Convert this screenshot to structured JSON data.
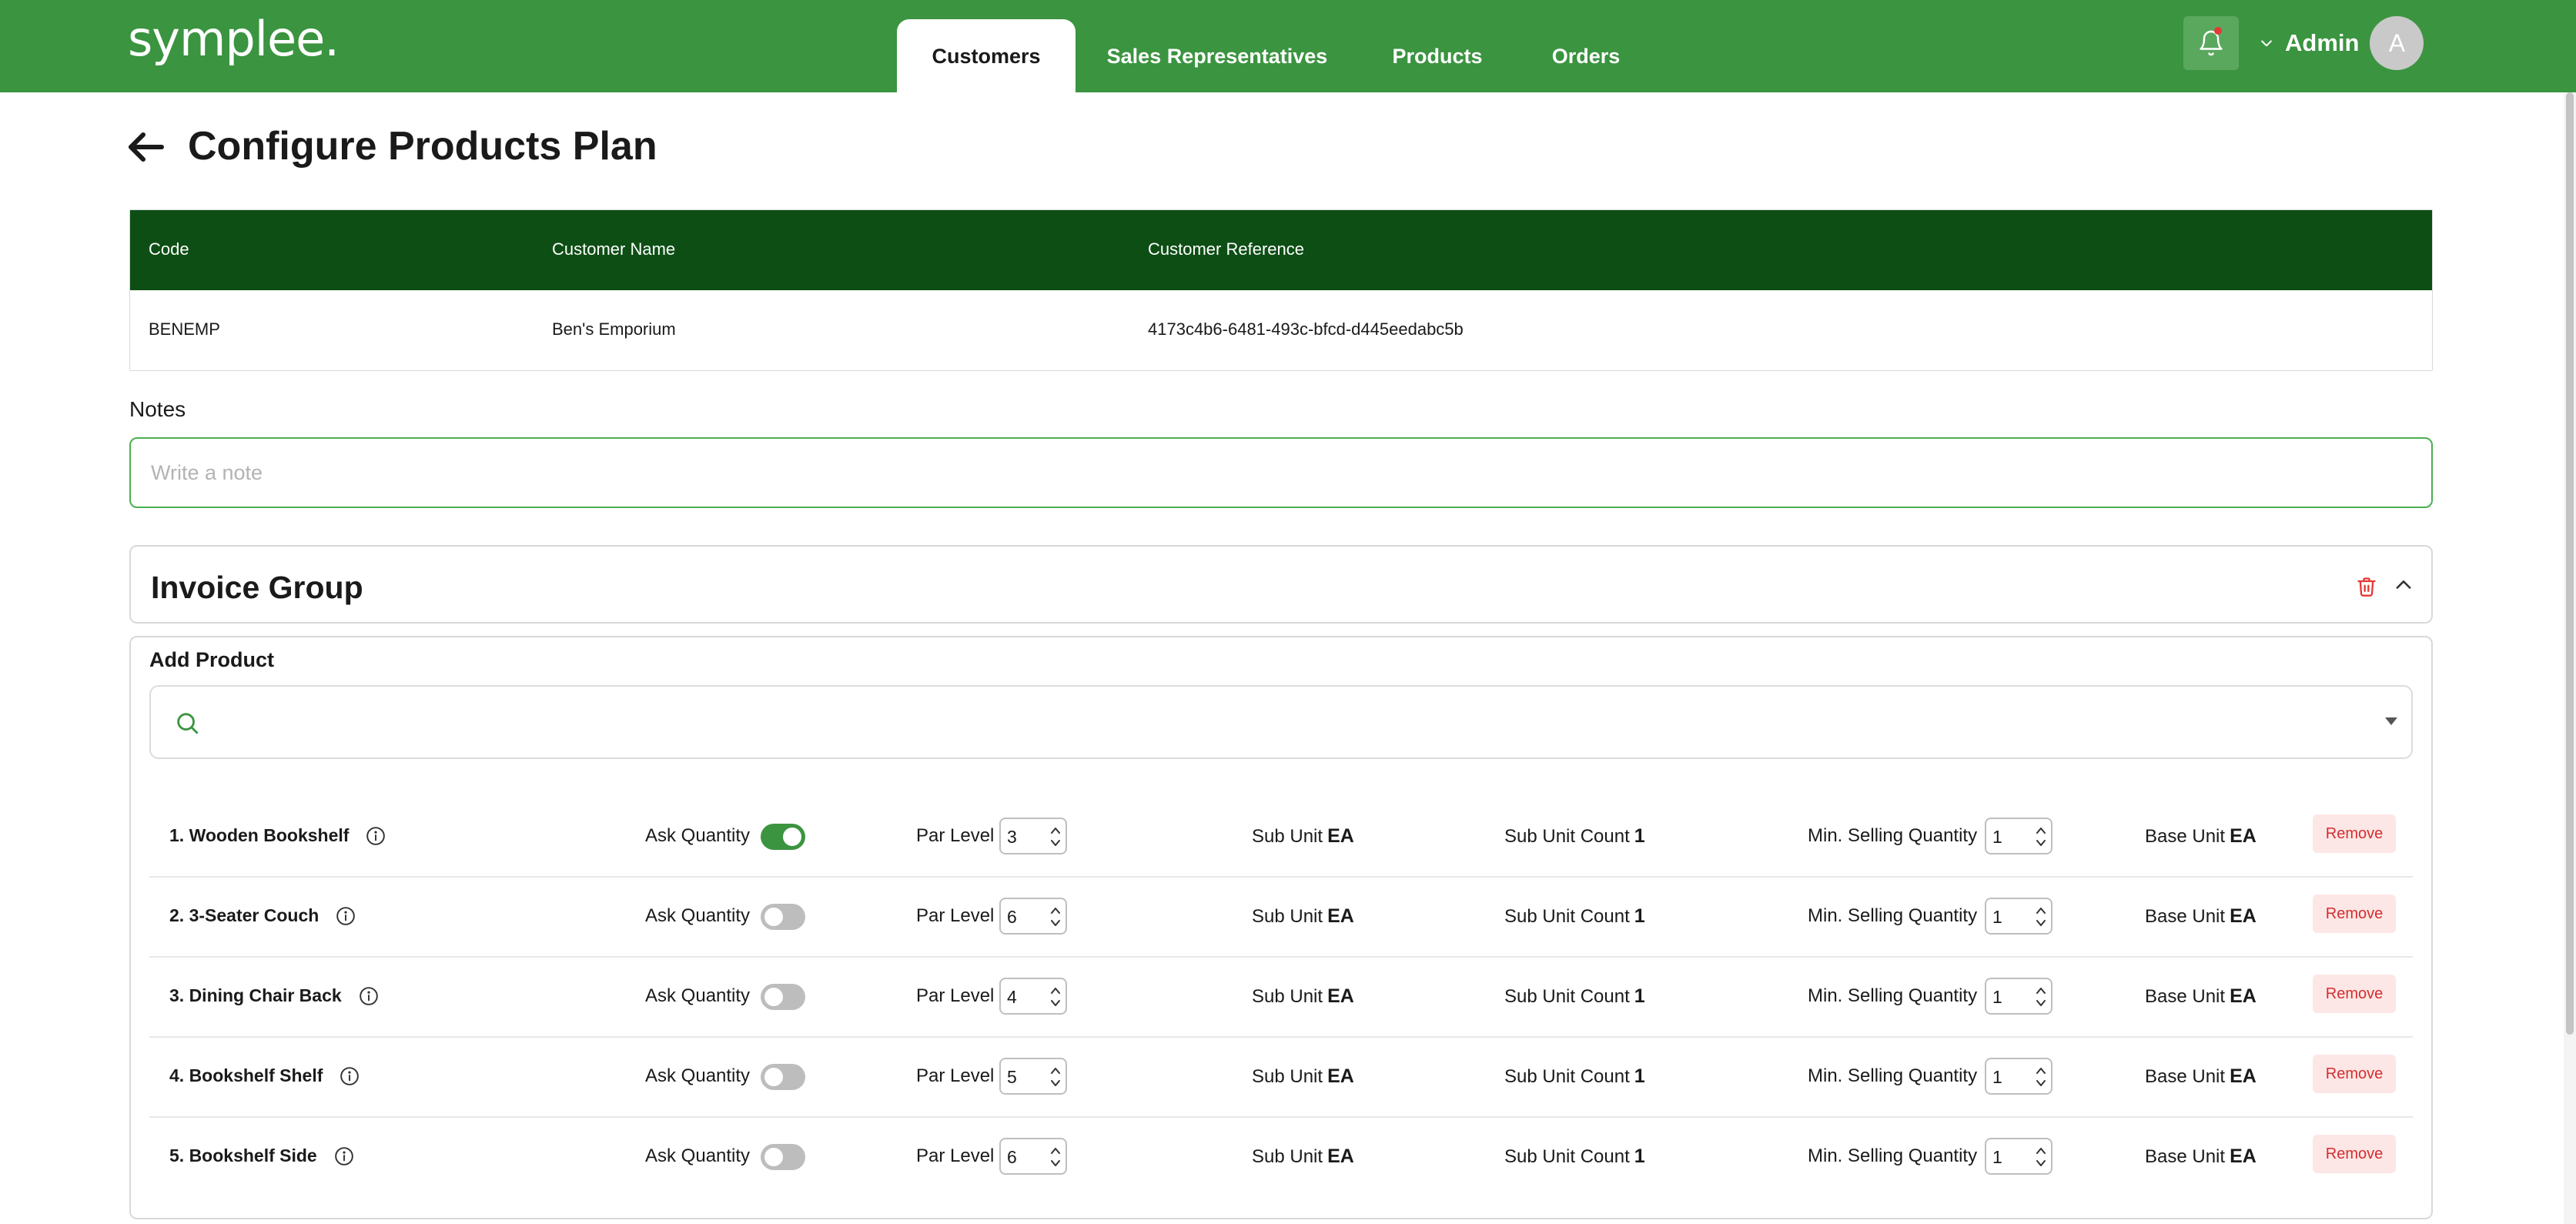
{
  "app": {
    "logo": "symplee."
  },
  "nav": {
    "tabs": [
      {
        "label": "Customers",
        "active": true
      },
      {
        "label": "Sales Representatives",
        "active": false
      },
      {
        "label": "Products",
        "active": false
      },
      {
        "label": "Orders",
        "active": false
      }
    ],
    "user": {
      "name": "Admin",
      "avatar_initial": "A"
    },
    "icons": {
      "notifications": "bell-icon",
      "user_menu": "chevron-down-icon"
    }
  },
  "page": {
    "title": "Configure Products Plan",
    "back_icon": "arrow-left-icon"
  },
  "customer_table": {
    "headers": [
      "Code",
      "Customer Name",
      "Customer Reference"
    ],
    "row": [
      "BENEMP",
      "Ben's Emporium",
      "4173c4b6-6481-493c-bfcd-d445eedabc5b"
    ]
  },
  "notes": {
    "label": "Notes",
    "placeholder": "Write a note",
    "value": ""
  },
  "invoice_group": {
    "title": "Invoice Group",
    "add_product_label": "Add Product",
    "search_value": "",
    "labels": {
      "ask_quantity": "Ask Quantity",
      "par_level": "Par Level",
      "sub_unit": "Sub Unit",
      "sub_unit_count": "Sub Unit Count",
      "min_selling_quantity": "Min. Selling Quantity",
      "base_unit": "Base Unit",
      "remove": "Remove"
    },
    "products": [
      {
        "name": "1. Wooden Bookshelf",
        "ask_quantity": true,
        "par_level": "3",
        "sub_unit": "EA",
        "sub_unit_count": "1",
        "min_selling_quantity": "1",
        "base_unit": "EA"
      },
      {
        "name": "2. 3-Seater Couch",
        "ask_quantity": false,
        "par_level": "6",
        "sub_unit": "EA",
        "sub_unit_count": "1",
        "min_selling_quantity": "1",
        "base_unit": "EA"
      },
      {
        "name": "3. Dining Chair Back",
        "ask_quantity": false,
        "par_level": "4",
        "sub_unit": "EA",
        "sub_unit_count": "1",
        "min_selling_quantity": "1",
        "base_unit": "EA"
      },
      {
        "name": "4. Bookshelf Shelf",
        "ask_quantity": false,
        "par_level": "5",
        "sub_unit": "EA",
        "sub_unit_count": "1",
        "min_selling_quantity": "1",
        "base_unit": "EA"
      },
      {
        "name": "5. Bookshelf Side",
        "ask_quantity": false,
        "par_level": "6",
        "sub_unit": "EA",
        "sub_unit_count": "1",
        "min_selling_quantity": "1",
        "base_unit": "EA"
      }
    ]
  },
  "colors": {
    "brand_green": "#3b9440",
    "table_header_green": "#0d4e14",
    "danger_red": "#d32f2f",
    "remove_bg": "#fde6e6"
  }
}
